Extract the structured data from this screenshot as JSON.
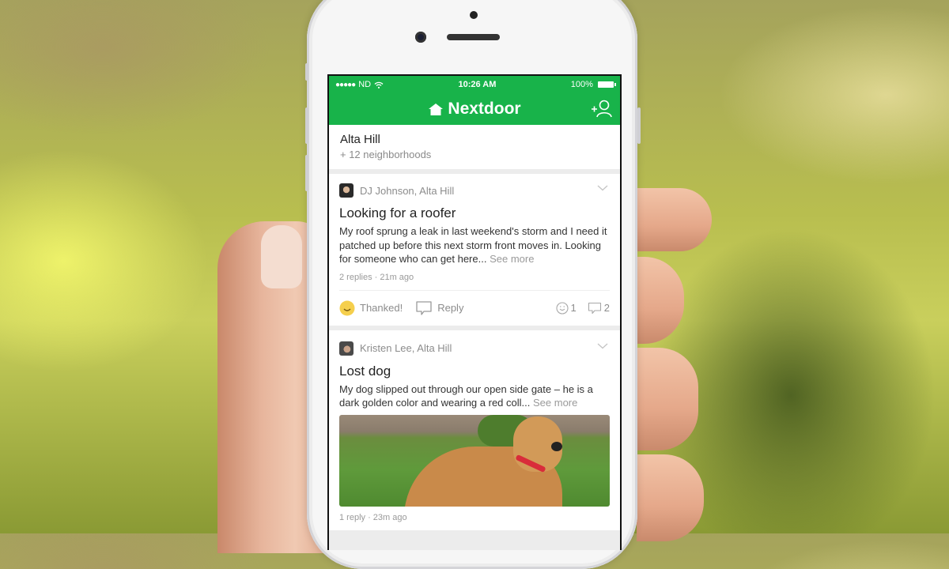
{
  "status_bar": {
    "carrier": "ND",
    "time": "10:26 AM",
    "battery": "100%"
  },
  "app": {
    "title": "Nextdoor",
    "brand_color": "#18b34a",
    "header_icons": [
      "house-icon",
      "add-user-icon"
    ]
  },
  "neighborhood": {
    "name": "Alta Hill",
    "subtitle": "+ 12 neighborhoods"
  },
  "posts": [
    {
      "author": "DJ Johnson, Alta Hill",
      "title": "Looking for a roofer",
      "body": "My roof sprung a leak in last weekend's storm and I need it patched up before this next storm front moves in. Looking for someone who can get here...",
      "see_more": "See more",
      "meta": "2 replies · 21m ago",
      "thank_label": "Thanked!",
      "reply_label": "Reply",
      "thanks_count": "1",
      "reply_count": "2"
    },
    {
      "author": "Kristen Lee, Alta Hill",
      "title": "Lost dog",
      "body": "My dog slipped out through our open side gate – he is a dark golden color and wearing a red coll...",
      "see_more": "See more",
      "meta": "1 reply · 23m ago",
      "image": "photo of golden dog with red collar lying on grass"
    }
  ]
}
